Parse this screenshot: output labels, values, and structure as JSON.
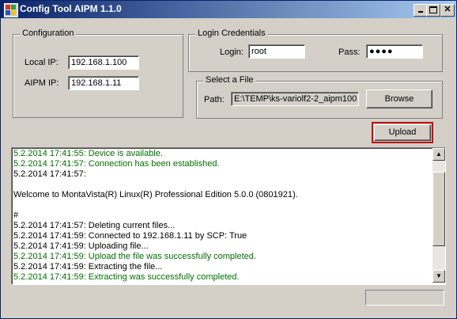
{
  "window": {
    "title": "Config Tool AIPM 1.1.0",
    "controls": [
      "minimize",
      "maximize",
      "close"
    ]
  },
  "configuration": {
    "group_label": "Configuration",
    "local_ip_label": "Local IP:",
    "local_ip_value": "192.168.1.100",
    "aipm_ip_label": "AIPM IP:",
    "aipm_ip_value": "192.168.1.11"
  },
  "credentials": {
    "group_label": "Login Credentials",
    "login_label": "Login:",
    "login_value": "root",
    "pass_label": "Pass:",
    "pass_value": "●●●●"
  },
  "file": {
    "group_label": "Select a File",
    "path_label": "Path:",
    "path_value": "E:\\TEMP\\ks-variolf2-2_aipm100",
    "browse_label": "Browse"
  },
  "upload": {
    "label": "Upload"
  },
  "log": {
    "lines": [
      {
        "text": "5.2.2014 17:41:55: Device is available.",
        "color": "#007000"
      },
      {
        "text": "5.2.2014 17:41:57: Connection has been established.",
        "color": "#007000"
      },
      {
        "text": "5.2.2014 17:41:57:",
        "color": "#000000"
      },
      {
        "text": "",
        "color": "#000000"
      },
      {
        "text": "Welcome to MontaVista(R) Linux(R) Professional Edition 5.0.0 (0801921).",
        "color": "#000000"
      },
      {
        "text": "",
        "color": "#000000"
      },
      {
        "text": "#",
        "color": "#000000"
      },
      {
        "text": "5.2.2014 17:41:57: Deleting current files...",
        "color": "#000000"
      },
      {
        "text": "5.2.2014 17:41:59: Connected to 192.168.1.11 by SCP: True",
        "color": "#000000"
      },
      {
        "text": "5.2.2014 17:41:59: Uploading file...",
        "color": "#000000"
      },
      {
        "text": "5.2.2014 17:41:59: Upload the file was successfully completed.",
        "color": "#007000"
      },
      {
        "text": "5.2.2014 17:41:59: Extracting the file...",
        "color": "#000000"
      },
      {
        "text": "5.2.2014 17:41:59: Extracting was successfully completed.",
        "color": "#007000"
      }
    ]
  },
  "progress": {
    "fraction": 0
  },
  "colors": {
    "titlebar_start": "#0a246a",
    "success_text": "#007000",
    "upload_highlight": "#c00000",
    "window_bg": "#d4d0c8"
  }
}
